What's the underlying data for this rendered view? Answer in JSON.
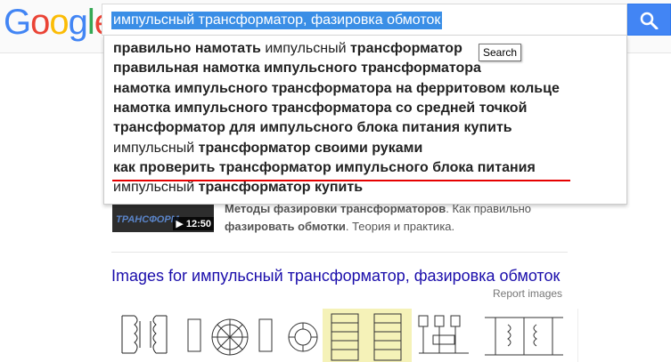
{
  "header": {
    "logo_letters": [
      "G",
      "o",
      "o",
      "g",
      "l",
      "e"
    ],
    "search_query": "импульсный трансформатор, фазировка обмоток",
    "search_button_icon": "magnifier-icon",
    "tooltip": "Search"
  },
  "suggestions": [
    {
      "parts": [
        {
          "t": "правильно намотать ",
          "b": true
        },
        {
          "t": "импульсный",
          "b": false
        },
        {
          "t": " трансформатор",
          "b": true
        }
      ]
    },
    {
      "parts": [
        {
          "t": "правильная намотка импульсного трансформатора",
          "b": true
        }
      ]
    },
    {
      "parts": [
        {
          "t": "намотка импульсного трансформатора на ферритовом кольце",
          "b": true
        }
      ]
    },
    {
      "parts": [
        {
          "t": "намотка импульсного трансформатора со средней точкой",
          "b": true
        }
      ]
    },
    {
      "parts": [
        {
          "t": "трансформатор для импульсного блока питания купить",
          "b": true
        }
      ]
    },
    {
      "parts": [
        {
          "t": "импульсный",
          "b": false
        },
        {
          "t": " трансформатор своими руками",
          "b": true
        }
      ]
    },
    {
      "parts": [
        {
          "t": "как проверить трансформатор импульсного блока питания",
          "b": true
        }
      ]
    },
    {
      "parts": [
        {
          "t": "импульсный",
          "b": false
        },
        {
          "t": " трансформатор купить",
          "b": true
        }
      ]
    }
  ],
  "result": {
    "thumb_text": "ТРАНСФОРМ",
    "video_duration": "12:50",
    "snippet_bold_1": "Методы фазировки трансформаторов",
    "snippet_rest_1": ". Как правильно",
    "snippet_bold_2": "фазировать обмотки",
    "snippet_rest_2": ". Теория и практика."
  },
  "images_section": {
    "heading": "Images for импульсный трансформатор, фазировка обмоток",
    "report": "Report images"
  },
  "colors": {
    "logo_blue": "#4285f4",
    "logo_red": "#ea4335",
    "logo_yellow": "#fbbc05",
    "logo_green": "#34a853",
    "link": "#1a0dab",
    "search_button": "#4285f4",
    "annotation_underline": "#e60000"
  }
}
